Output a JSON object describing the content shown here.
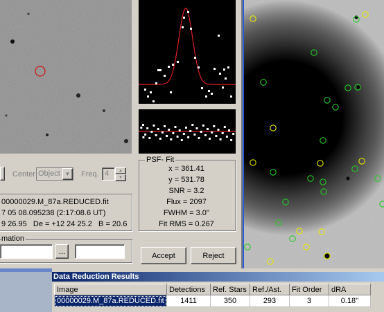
{
  "controls": {
    "center_label": "Center",
    "center_value": "Object",
    "freq_label": "Freq.",
    "freq_value": "4",
    "stepper_value": ""
  },
  "info": {
    "line1": "00000029.M_87a.REDUCED.fit",
    "line2": "7 05 08.095238 (2:17:08.6 UT)",
    "line3": "9 26.95   De = +12 24 25.2   B = 20.6"
  },
  "confirmation": {
    "group_label": "mation",
    "browse_label": "...",
    "field_value": ""
  },
  "psf_fit": {
    "title": "PSF- Fit",
    "x": "x = 361.41",
    "y": "y = 531.78",
    "snr": "SNR = 3.2",
    "flux": "Flux = 2097",
    "fwhm": "FWHM = 3.0''",
    "fit_rms": "Fit RMS = 0.267"
  },
  "buttons": {
    "accept": "Accept",
    "reject": "Reject"
  },
  "results": {
    "title": "Data Reduction Results",
    "columns": [
      "Image",
      "Detections",
      "Ref. Stars",
      "Ref./Ast.",
      "Fit Order",
      "dRA"
    ],
    "rows": [
      [
        "00000029.M_87a.REDUCED.fit",
        "1411",
        "350",
        "293",
        "3",
        "0.18''"
      ]
    ]
  },
  "colors": {
    "fit_curve": "#e02020",
    "ref_star_marker": "#22cc22",
    "asteroid_marker": "#e8e800",
    "selection": "#0a246a"
  }
}
